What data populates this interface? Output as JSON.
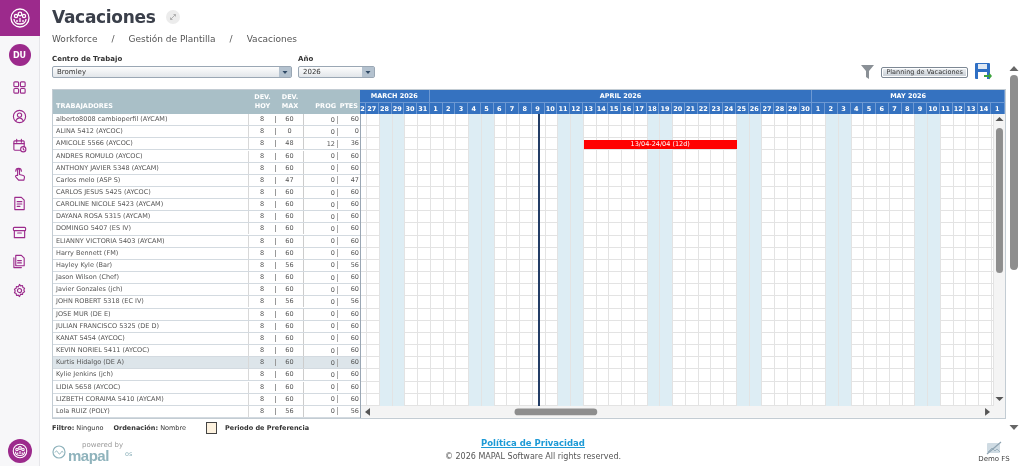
{
  "sidebar": {
    "avatar": "DU"
  },
  "header": {
    "title": "Vacaciones",
    "breadcrumb": [
      "Workforce",
      "Gestión de Plantilla",
      "Vacaciones"
    ],
    "separator": "/"
  },
  "filters": [
    {
      "label": "Centro de Trabajo",
      "value": "Bromley"
    },
    {
      "label": "Año",
      "value": "2026"
    }
  ],
  "toolbar": {
    "button": "Planning de Vacaciones"
  },
  "table": {
    "columns": [
      "TRABAJADORES",
      "DEV. HOY",
      "DEV. MAX",
      "PROG",
      "PTES"
    ],
    "months": [
      {
        "label": "MARCH 2026",
        "days": [
          {
            "label": "2",
            "weekend": false,
            "today": false
          },
          {
            "label": "27",
            "weekend": false,
            "today": false
          },
          {
            "label": "28",
            "weekend": true,
            "today": false
          },
          {
            "label": "29",
            "weekend": true,
            "today": false
          },
          {
            "label": "30",
            "weekend": false,
            "today": false
          },
          {
            "label": "31",
            "weekend": false,
            "today": false
          }
        ]
      },
      {
        "label": "APRIL 2026",
        "days": [
          {
            "label": "1",
            "weekend": false,
            "today": false
          },
          {
            "label": "2",
            "weekend": false,
            "today": false
          },
          {
            "label": "3",
            "weekend": false,
            "today": false
          },
          {
            "label": "4",
            "weekend": true,
            "today": false
          },
          {
            "label": "5",
            "weekend": true,
            "today": false
          },
          {
            "label": "6",
            "weekend": false,
            "today": false
          },
          {
            "label": "7",
            "weekend": false,
            "today": false
          },
          {
            "label": "8",
            "weekend": false,
            "today": false
          },
          {
            "label": "9",
            "weekend": false,
            "today": true
          },
          {
            "label": "10",
            "weekend": false,
            "today": false
          },
          {
            "label": "11",
            "weekend": true,
            "today": false
          },
          {
            "label": "12",
            "weekend": true,
            "today": false
          },
          {
            "label": "13",
            "weekend": false,
            "today": false
          },
          {
            "label": "14",
            "weekend": false,
            "today": false
          },
          {
            "label": "15",
            "weekend": false,
            "today": false
          },
          {
            "label": "16",
            "weekend": false,
            "today": false
          },
          {
            "label": "17",
            "weekend": false,
            "today": false
          },
          {
            "label": "18",
            "weekend": true,
            "today": false
          },
          {
            "label": "19",
            "weekend": true,
            "today": false
          },
          {
            "label": "20",
            "weekend": false,
            "today": false
          },
          {
            "label": "21",
            "weekend": false,
            "today": false
          },
          {
            "label": "22",
            "weekend": false,
            "today": false
          },
          {
            "label": "23",
            "weekend": false,
            "today": false
          },
          {
            "label": "24",
            "weekend": false,
            "today": false
          },
          {
            "label": "25",
            "weekend": true,
            "today": false
          },
          {
            "label": "26",
            "weekend": true,
            "today": false
          },
          {
            "label": "27",
            "weekend": false,
            "today": false
          },
          {
            "label": "28",
            "weekend": false,
            "today": false
          },
          {
            "label": "29",
            "weekend": false,
            "today": false
          },
          {
            "label": "30",
            "weekend": false,
            "today": false
          }
        ]
      },
      {
        "label": "MAY 2026",
        "days": [
          {
            "label": "1",
            "weekend": false,
            "today": false
          },
          {
            "label": "2",
            "weekend": true,
            "today": false
          },
          {
            "label": "3",
            "weekend": true,
            "today": false
          },
          {
            "label": "4",
            "weekend": false,
            "today": false
          },
          {
            "label": "5",
            "weekend": false,
            "today": false
          },
          {
            "label": "6",
            "weekend": false,
            "today": false
          },
          {
            "label": "7",
            "weekend": false,
            "today": false
          },
          {
            "label": "8",
            "weekend": false,
            "today": false
          },
          {
            "label": "9",
            "weekend": true,
            "today": false
          },
          {
            "label": "10",
            "weekend": true,
            "today": false
          },
          {
            "label": "11",
            "weekend": false,
            "today": false
          },
          {
            "label": "12",
            "weekend": false,
            "today": false
          },
          {
            "label": "13",
            "weekend": false,
            "today": false
          },
          {
            "label": "14",
            "weekend": false,
            "today": false
          },
          {
            "label": "1",
            "weekend": false,
            "today": false
          }
        ]
      }
    ],
    "rows": [
      {
        "name": "alberto8008 cambioperfil (AYCAM)",
        "hoy": "8",
        "max": "60",
        "prog": "0",
        "ptes": "60",
        "selected": false
      },
      {
        "name": "ALINA 5412 (AYCOC)",
        "hoy": "8",
        "max": "0",
        "prog": "0",
        "ptes": "0",
        "selected": false
      },
      {
        "name": "AMICOLE 5566 (AYCOC)",
        "hoy": "8",
        "max": "48",
        "prog": "12",
        "ptes": "36",
        "selected": false,
        "bar": {
          "label": "13/04-24/04 (12d)",
          "color": "#ff0000"
        }
      },
      {
        "name": "ANDRES ROMULO (AYCOC)",
        "hoy": "8",
        "max": "60",
        "prog": "0",
        "ptes": "60",
        "selected": false
      },
      {
        "name": "ANTHONY JAVIER 5348 (AYCAM)",
        "hoy": "8",
        "max": "60",
        "prog": "0",
        "ptes": "60",
        "selected": false
      },
      {
        "name": "Carlos melo (ASP S)",
        "hoy": "8",
        "max": "47",
        "prog": "0",
        "ptes": "47",
        "selected": false
      },
      {
        "name": "CARLOS JESUS 5425 (AYCOC)",
        "hoy": "8",
        "max": "60",
        "prog": "0",
        "ptes": "60",
        "selected": false
      },
      {
        "name": "CAROLINE NICOLE 5423 (AYCAM)",
        "hoy": "8",
        "max": "60",
        "prog": "0",
        "ptes": "60",
        "selected": false
      },
      {
        "name": "DAYANA ROSA 5315 (AYCAM)",
        "hoy": "8",
        "max": "60",
        "prog": "0",
        "ptes": "60",
        "selected": false
      },
      {
        "name": "DOMINGO 5407 (ES IV)",
        "hoy": "8",
        "max": "60",
        "prog": "0",
        "ptes": "60",
        "selected": false
      },
      {
        "name": "ELIANNY VICTORIA 5403 (AYCAM)",
        "hoy": "8",
        "max": "60",
        "prog": "0",
        "ptes": "60",
        "selected": false
      },
      {
        "name": "Harry Bennett (FM)",
        "hoy": "8",
        "max": "60",
        "prog": "0",
        "ptes": "60",
        "selected": false
      },
      {
        "name": "Hayley Kyle (Bar)",
        "hoy": "8",
        "max": "56",
        "prog": "0",
        "ptes": "56",
        "selected": false
      },
      {
        "name": "Jason Wilson (Chef)",
        "hoy": "8",
        "max": "60",
        "prog": "0",
        "ptes": "60",
        "selected": false
      },
      {
        "name": "Javier Gonzales (jch)",
        "hoy": "8",
        "max": "60",
        "prog": "0",
        "ptes": "60",
        "selected": false
      },
      {
        "name": "JOHN ROBERT 5318 (EC IV)",
        "hoy": "8",
        "max": "56",
        "prog": "0",
        "ptes": "56",
        "selected": false
      },
      {
        "name": "JOSE MUR (DE E)",
        "hoy": "8",
        "max": "60",
        "prog": "0",
        "ptes": "60",
        "selected": false
      },
      {
        "name": "JULIAN FRANCISCO 5325 (DE D)",
        "hoy": "8",
        "max": "60",
        "prog": "0",
        "ptes": "60",
        "selected": false
      },
      {
        "name": "KANAT 5454 (AYCOC)",
        "hoy": "8",
        "max": "60",
        "prog": "0",
        "ptes": "60",
        "selected": false
      },
      {
        "name": "KEVIN NORIEL 5411 (AYCOC)",
        "hoy": "8",
        "max": "60",
        "prog": "0",
        "ptes": "60",
        "selected": false
      },
      {
        "name": "Kurtis Hidalgo (DE A)",
        "hoy": "8",
        "max": "60",
        "prog": "0",
        "ptes": "60",
        "selected": true
      },
      {
        "name": "Kylie Jenkins (jch)",
        "hoy": "8",
        "max": "60",
        "prog": "0",
        "ptes": "60",
        "selected": false
      },
      {
        "name": "LIDIA 5658 (AYCOC)",
        "hoy": "8",
        "max": "60",
        "prog": "0",
        "ptes": "60",
        "selected": false
      },
      {
        "name": "LIZBETH CORAIMA 5410 (AYCAM)",
        "hoy": "8",
        "max": "60",
        "prog": "0",
        "ptes": "60",
        "selected": false
      },
      {
        "name": "Lola RUIZ (POLY)",
        "hoy": "8",
        "max": "56",
        "prog": "0",
        "ptes": "56",
        "selected": false
      }
    ]
  },
  "legend": {
    "filter": "**Filtro:** Ninguno",
    "order": "**Ordenación:** Nombre",
    "preference": "Periodo de Preferencia"
  },
  "footer": {
    "powered": "powered by",
    "brand": "mapal",
    "brand_suffix": "os",
    "privacy": "Política de Privacidad",
    "copyright": "© 2026 MAPAL Software All rights reserved.",
    "user": "Demo FS"
  }
}
